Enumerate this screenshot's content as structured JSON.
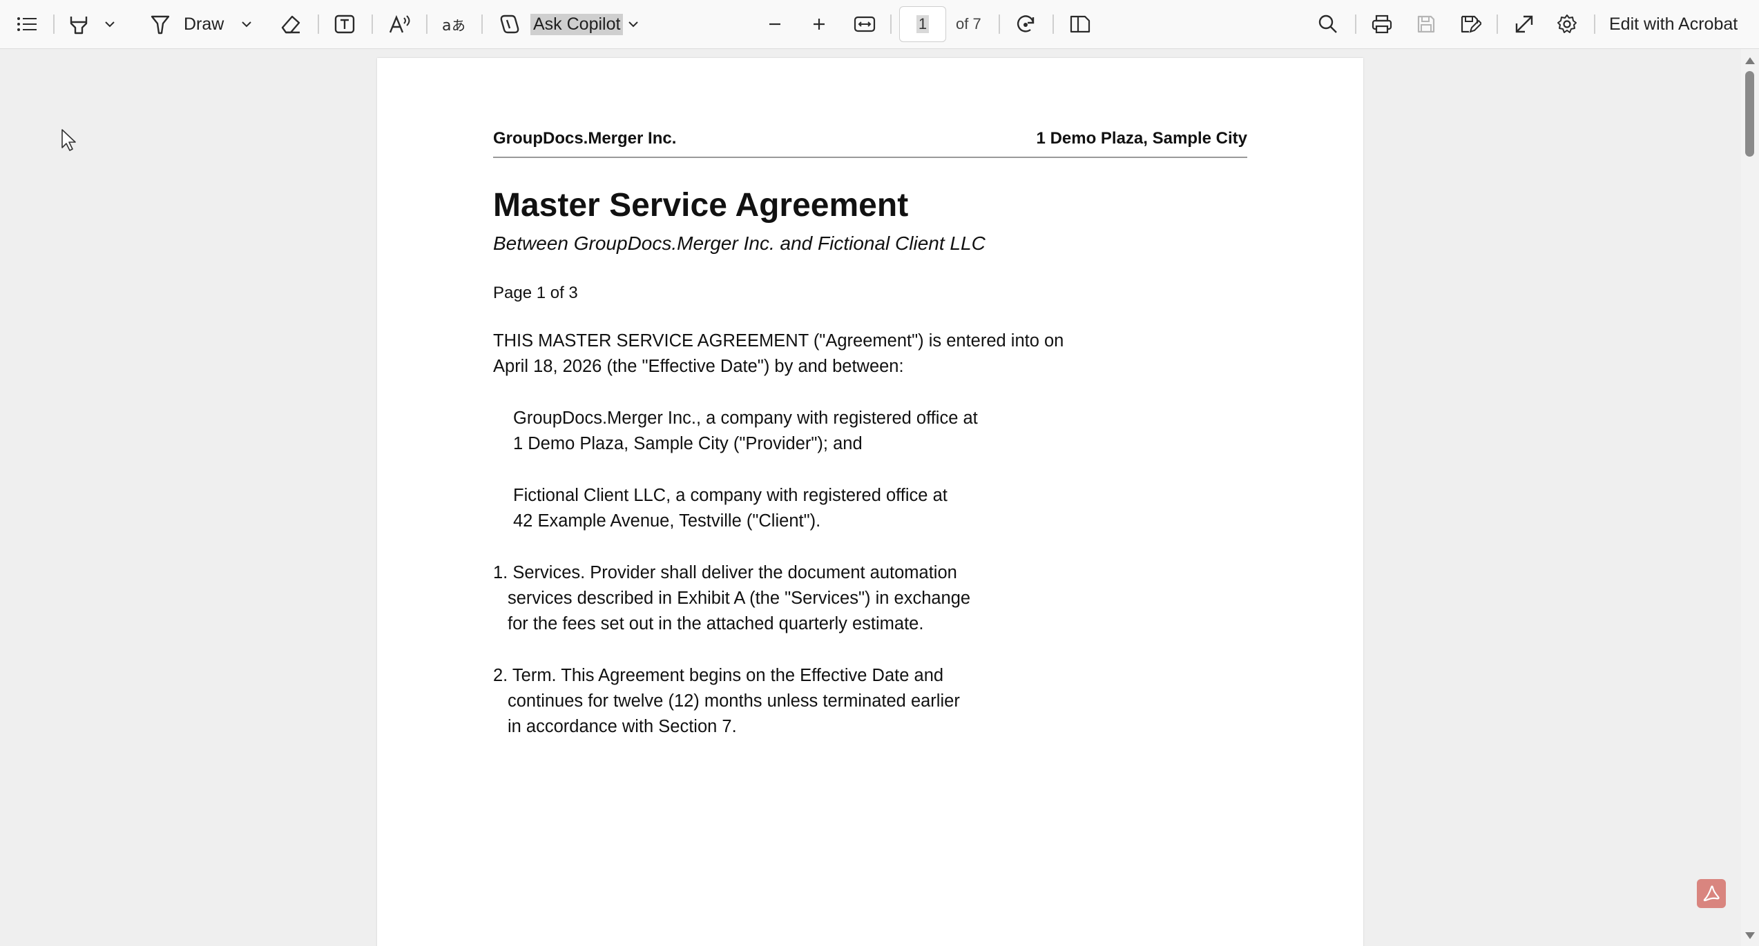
{
  "toolbar": {
    "draw_label": "Draw",
    "copilot_label": "Ask Copilot",
    "page_current": "1",
    "page_total_label": "of 7",
    "edit_acrobat_label": "Edit with Acrobat"
  },
  "icons": {
    "contents": "list-icon",
    "highlight": "highlighter-icon",
    "draw": "draw-pen-icon",
    "erase": "eraser-icon",
    "text": "text-box-icon",
    "read_aloud": "read-aloud-icon",
    "translate": "translate-icon",
    "copilot": "copilot-icon",
    "zoom_out": "minus-icon",
    "zoom_in": "plus-icon",
    "fit": "fit-width-icon",
    "rotate": "rotate-icon",
    "page_view": "page-view-icon",
    "search": "search-icon",
    "print": "print-icon",
    "save": "save-icon",
    "save_as": "save-as-icon",
    "fullscreen": "expand-icon",
    "settings": "gear-icon",
    "acrobat": "acrobat-icon"
  },
  "colors": {
    "acrobat_accent": "#d9857f",
    "copilot_highlight": "#cfcfcf"
  },
  "document": {
    "header_left": "GroupDocs.Merger Inc.",
    "header_right": "1 Demo Plaza, Sample City",
    "title": "Master Service Agreement",
    "subtitle": "Between GroupDocs.Merger Inc. and Fictional Client LLC",
    "page_label": "Page 1 of 3",
    "intro_lines": [
      "THIS MASTER SERVICE AGREEMENT (\"Agreement\") is entered into on",
      "April 18, 2026 (the \"Effective Date\") by and between:"
    ],
    "party1_lines": [
      "GroupDocs.Merger Inc., a company with registered office at",
      "1 Demo Plaza, Sample City (\"Provider\"); and"
    ],
    "party2_lines": [
      "Fictional Client LLC, a company with registered office at",
      "42 Example Avenue, Testville (\"Client\")."
    ],
    "clause1_lines": [
      "1. Services. Provider shall deliver the document automation",
      "services described in Exhibit A (the \"Services\") in exchange",
      "for the fees set out in the attached quarterly estimate."
    ],
    "clause2_lines": [
      "2. Term. This Agreement begins on the Effective Date and",
      "continues for twelve (12) months unless terminated earlier",
      "in accordance with Section 7."
    ]
  }
}
